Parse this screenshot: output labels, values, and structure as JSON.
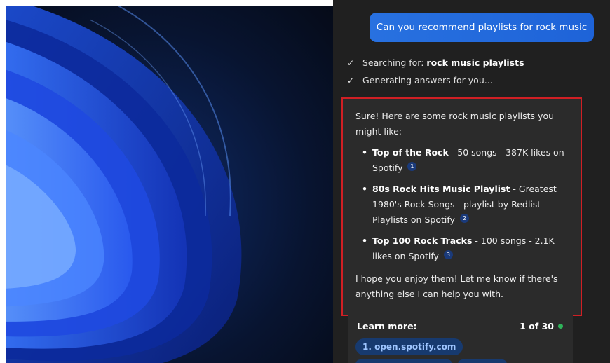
{
  "chat": {
    "user_message": "Can you recommend playlists for rock music",
    "status": {
      "searching_prefix": "Searching for:",
      "searching_query": "rock music playlists",
      "generating": "Generating answers for you..."
    },
    "answer": {
      "intro": "Sure! Here are some rock music playlists you might like:",
      "items": [
        {
          "title": "Top of the Rock",
          "detail": " - 50 songs - 387K likes on Spotify",
          "citation": "1"
        },
        {
          "title": "80s Rock Hits Music Playlist",
          "detail": " - Greatest 1980's Rock Songs - playlist by Redlist Playlists on Spotify",
          "citation": "2"
        },
        {
          "title": "Top 100 Rock Tracks",
          "detail": " - 100 songs - 2.1K likes on Spotify",
          "citation": "3"
        }
      ],
      "outro": "I hope you enjoy them! Let me know if there's anything else I can help you with."
    },
    "learn_more": {
      "label": "Learn more:",
      "count": "1 of 30",
      "sources": [
        "1. open.spotify.com"
      ]
    }
  },
  "colors": {
    "user_bubble": "#2871e0",
    "highlight_border": "#d01f24",
    "panel_bg": "#202020",
    "card_bg": "#2b2b2b",
    "source_chip": "#173a6f",
    "status_dot": "#2fb35a"
  },
  "icons": {
    "status_check": "check-icon",
    "status_dot": "green-dot-icon"
  }
}
